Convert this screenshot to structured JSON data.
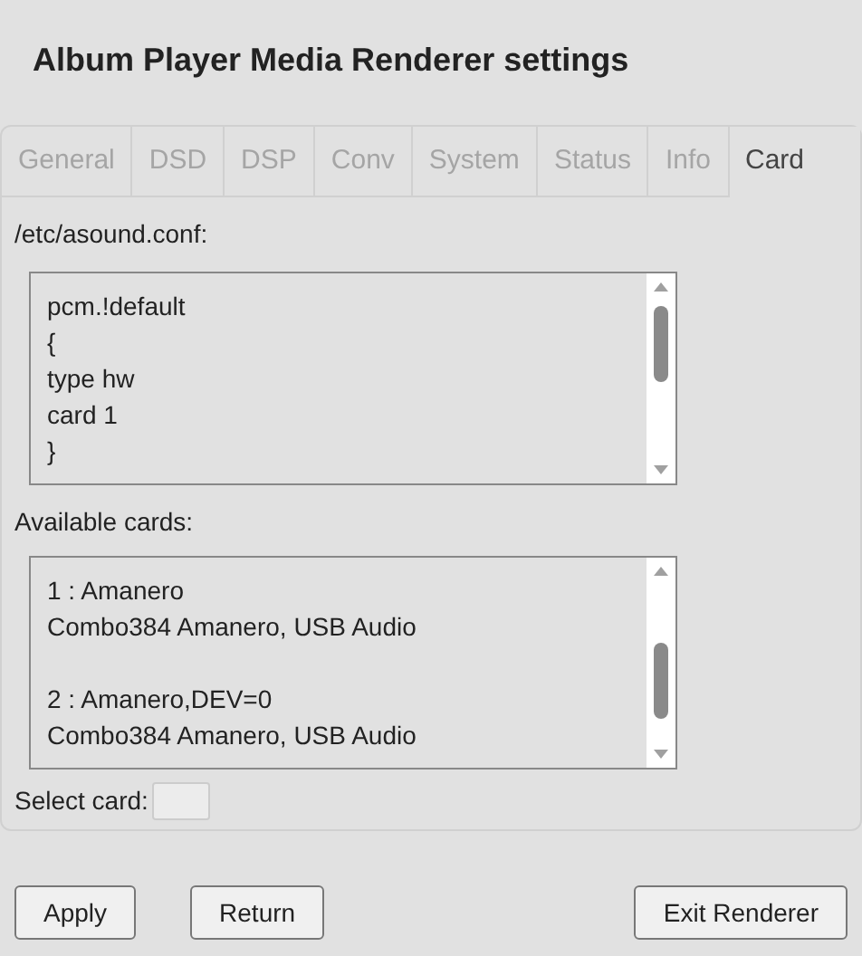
{
  "title": "Album Player Media Renderer settings",
  "tabs": [
    {
      "label": "General",
      "selected": false
    },
    {
      "label": "DSD",
      "selected": false
    },
    {
      "label": "DSP",
      "selected": false
    },
    {
      "label": "Conv",
      "selected": false
    },
    {
      "label": "System",
      "selected": false
    },
    {
      "label": "Status",
      "selected": false
    },
    {
      "label": "Info",
      "selected": false
    },
    {
      "label": "Card",
      "selected": true
    }
  ],
  "config": {
    "label": "/etc/asound.conf:",
    "lines": [
      "pcm.!default",
      "{",
      "type hw",
      "card 1",
      "}"
    ]
  },
  "cards": {
    "label": "Available cards:",
    "entries": [
      {
        "lines": [
          "1 : Amanero",
          "Combo384 Amanero, USB Audio"
        ]
      },
      {
        "lines": [
          "2 : Amanero,DEV=0",
          "Combo384 Amanero, USB Audio"
        ]
      }
    ]
  },
  "select_card": {
    "label": "Select card:"
  },
  "buttons": [
    "Apply",
    "Return",
    "Exit Renderer"
  ]
}
